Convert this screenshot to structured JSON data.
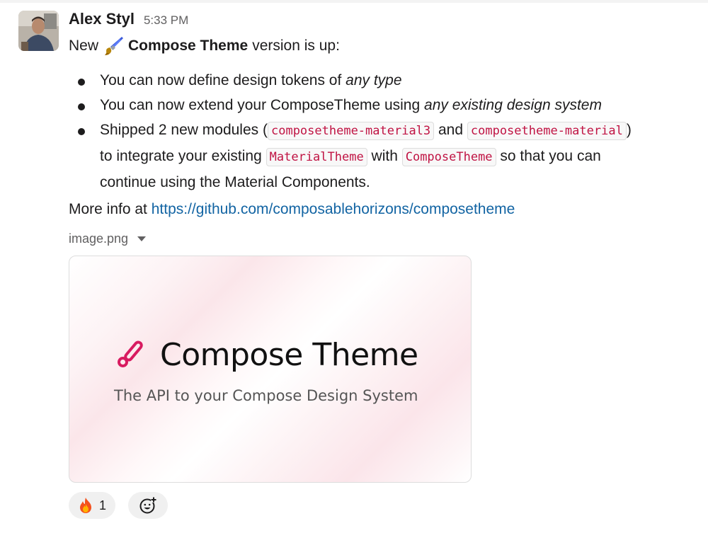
{
  "message": {
    "author": "Alex Styl",
    "timestamp": "5:33 PM",
    "intro": {
      "prefix": "New",
      "emoji": "paintbrush-emoji",
      "bold": "Compose Theme",
      "suffix": "version is up:"
    },
    "bullets": [
      {
        "text_before": "You can now define design tokens of ",
        "italic": "any type"
      },
      {
        "text_before": "You can now extend your ComposeTheme using ",
        "italic": "any existing design system"
      },
      {
        "part1": "Shipped 2 new modules (",
        "code1": "composetheme-material3",
        "part2": " and ",
        "code2": "composetheme-material",
        "part3": ")",
        "part4": "to integrate your existing ",
        "code3": "MaterialTheme",
        "part5": " with ",
        "code4": "ComposeTheme",
        "part6": " so that you can",
        "part7": "continue using the Material Components."
      }
    ],
    "more_info_label": "More info at ",
    "more_info_link": "https://github.com/composablehorizons/composetheme"
  },
  "attachment": {
    "filename": "image.png",
    "preview_title": "Compose Theme",
    "preview_subtitle": "The API to your Compose Design System",
    "accent_color": "#d81b60"
  },
  "reactions": [
    {
      "emoji": "fire-emoji",
      "count": "1"
    }
  ],
  "add_reaction_icon": "add-emoji-icon"
}
